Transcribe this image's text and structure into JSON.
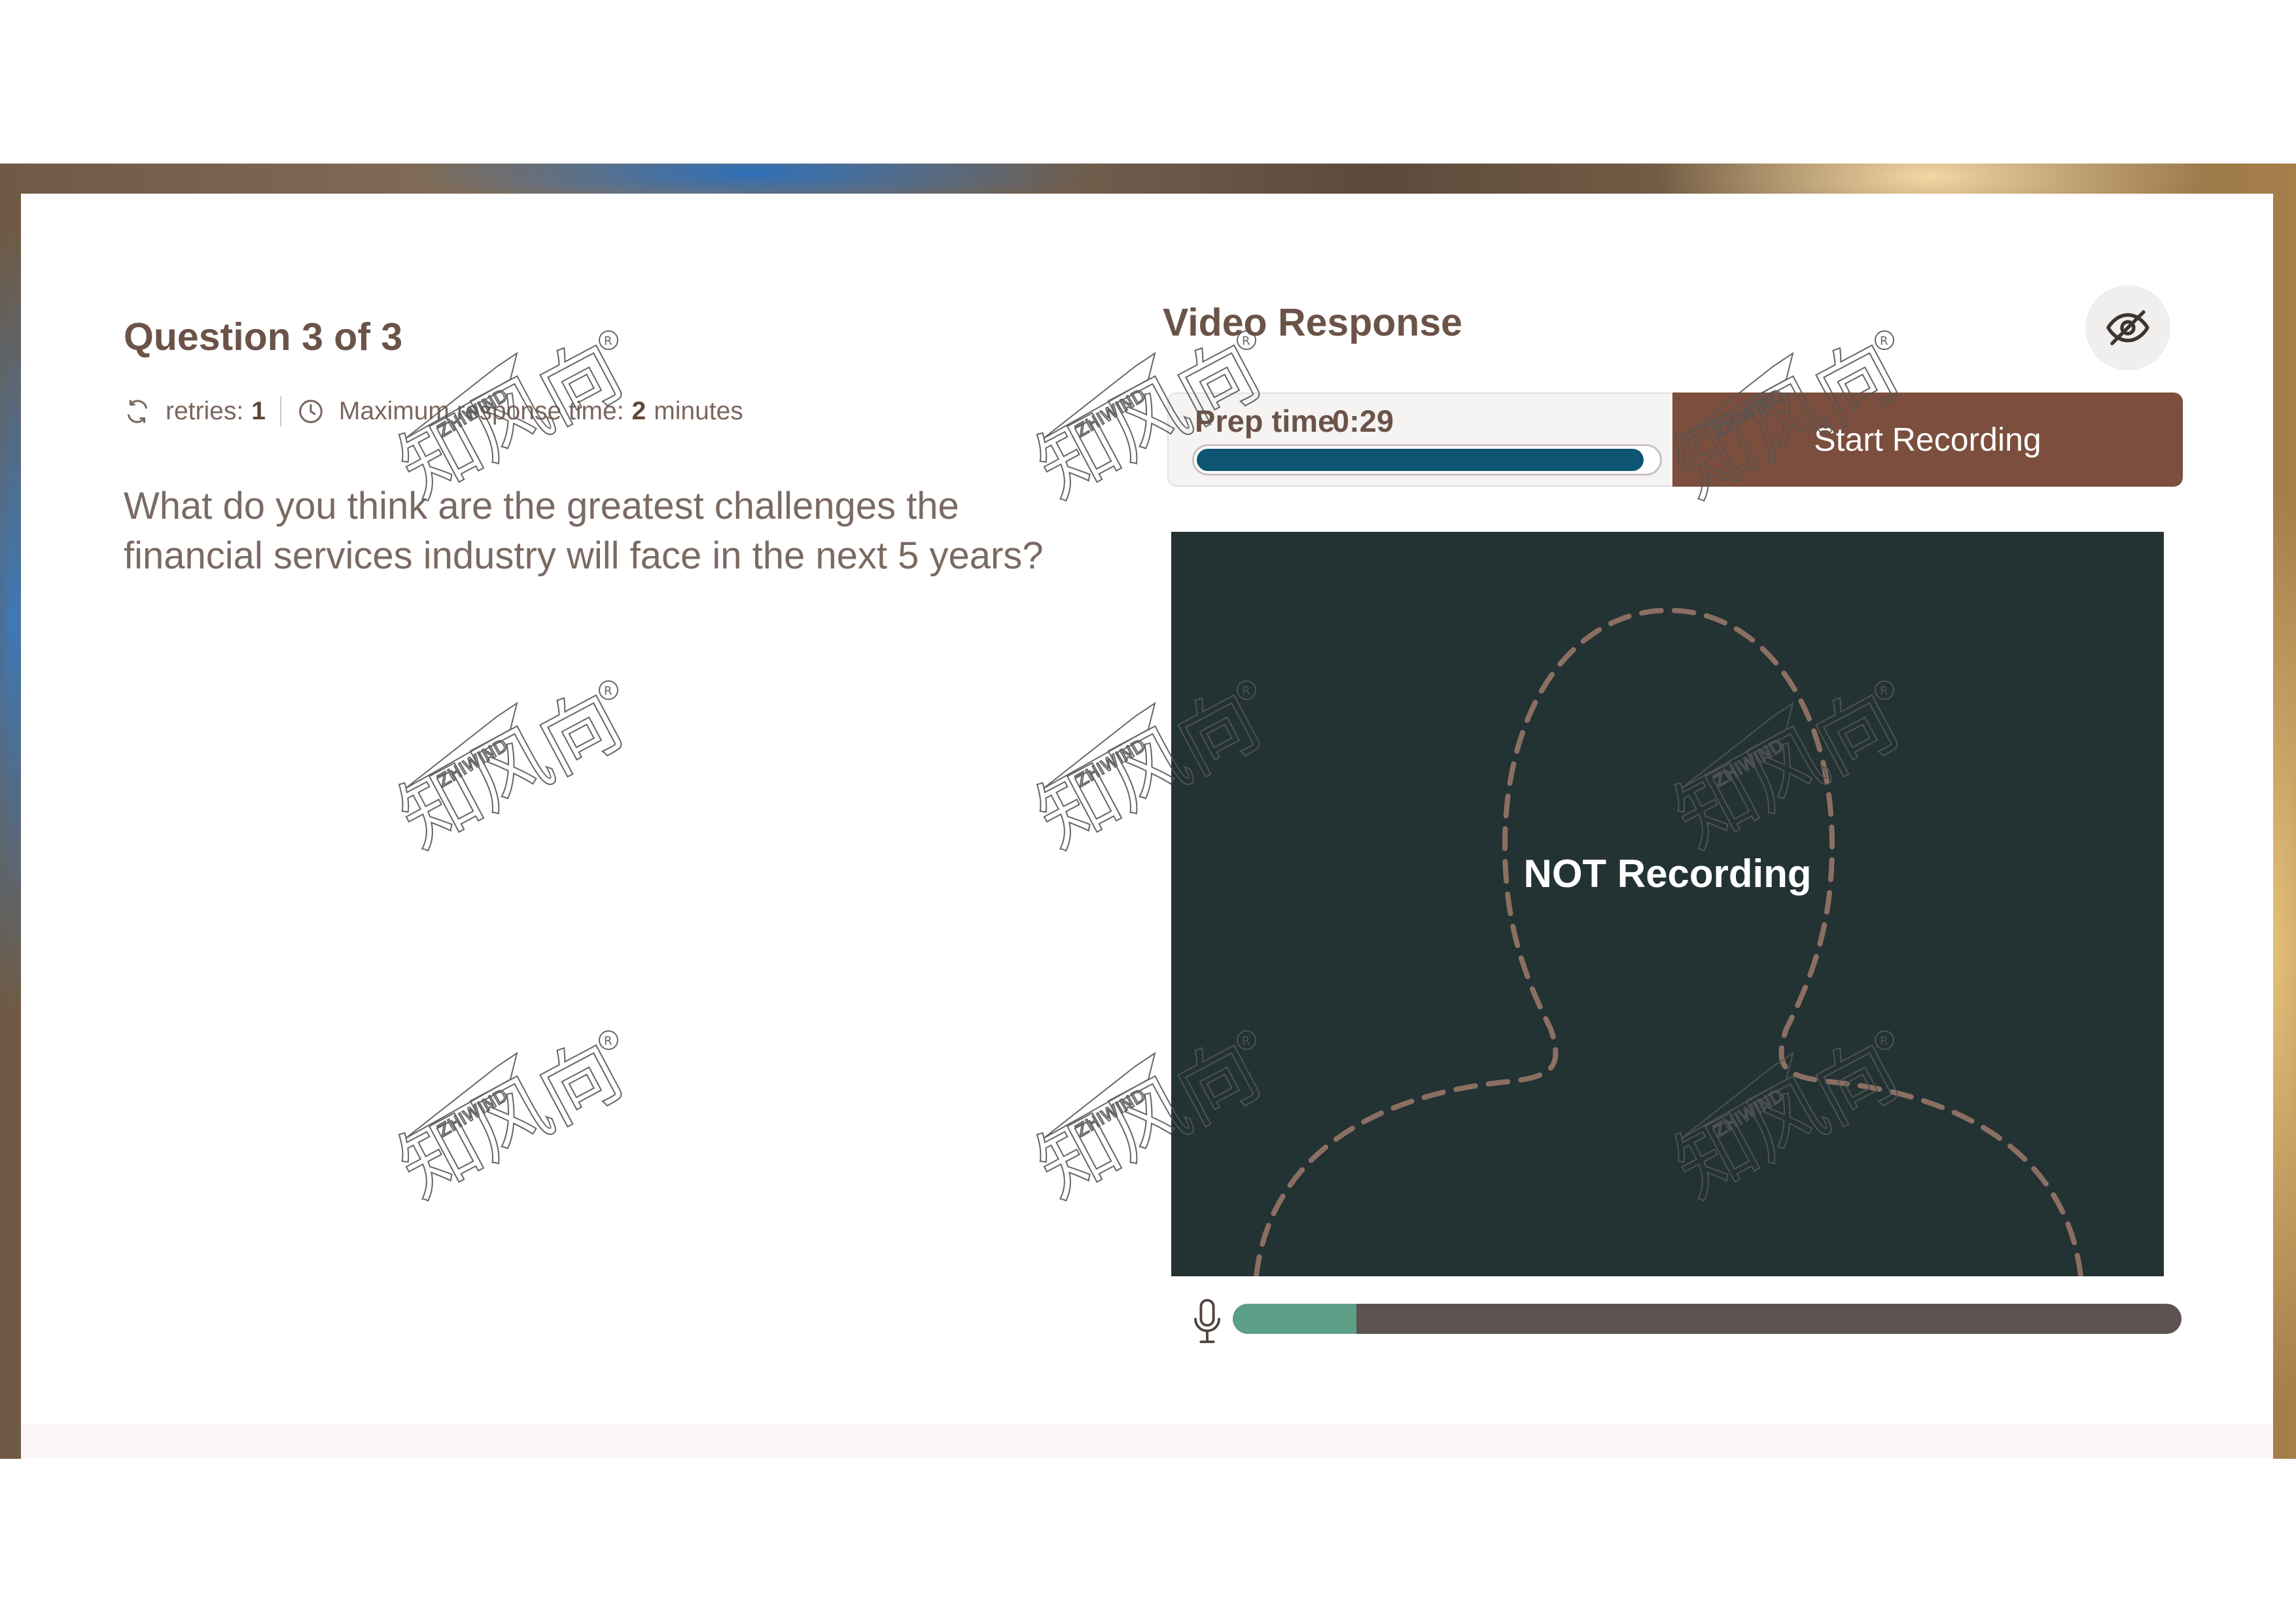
{
  "question": {
    "title": "Question 3 of 3",
    "retries_label": "retries:",
    "retries_value": "1",
    "max_time_label": "Maximum response time:",
    "max_time_value": "2",
    "max_time_unit": "minutes",
    "text": "What do you think are the greatest challenges the financial services industry will face in the next 5 years?"
  },
  "video_response": {
    "title": "Video Response",
    "hide_icon": "eye-slash-icon",
    "prep_label": "Prep time",
    "prep_time": "0:29",
    "prep_progress_fraction": 0.97,
    "start_button": "Start Recording",
    "status_text": "NOT Recording",
    "mic_icon": "microphone-icon",
    "mic_level_fraction": 0.13
  },
  "watermark": {
    "text": "知风向",
    "brand": "ZHIWIND"
  },
  "colors": {
    "brand_brown": "#7b4e3d",
    "heading": "#6b5348",
    "prep_fill": "#0e5573",
    "video_bg": "#233233",
    "mic_fill": "#5b9f87"
  }
}
